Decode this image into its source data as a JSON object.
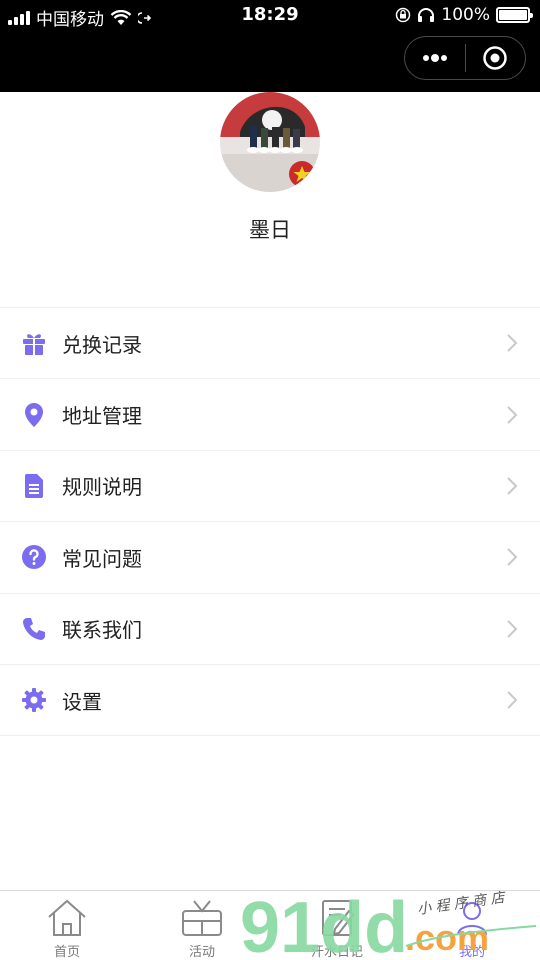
{
  "status_bar": {
    "carrier": "中国移动",
    "time": "18:29",
    "battery": "100%"
  },
  "profile": {
    "username": "墨日"
  },
  "menu": [
    {
      "label": "兑换记录",
      "icon": "gift-icon"
    },
    {
      "label": "地址管理",
      "icon": "location-pin-icon"
    },
    {
      "label": "规则说明",
      "icon": "document-icon"
    },
    {
      "label": "常见问题",
      "icon": "question-circle-icon"
    },
    {
      "label": "联系我们",
      "icon": "phone-icon"
    },
    {
      "label": "设置",
      "icon": "gear-icon"
    }
  ],
  "tabbar": [
    {
      "label": "首页",
      "icon": "home-icon"
    },
    {
      "label": "活动",
      "icon": "tv-icon"
    },
    {
      "label": "汗水日记",
      "icon": "diary-icon"
    },
    {
      "label": "我的",
      "icon": "profile-icon"
    }
  ],
  "watermark": {
    "logo": "91dd",
    "suffix": ".com",
    "tagline": "小 程 序 商 店"
  },
  "colors": {
    "accent": "#7b6cf0",
    "chevron": "#c8c8c8",
    "tab_inactive": "#7a7a7a"
  }
}
